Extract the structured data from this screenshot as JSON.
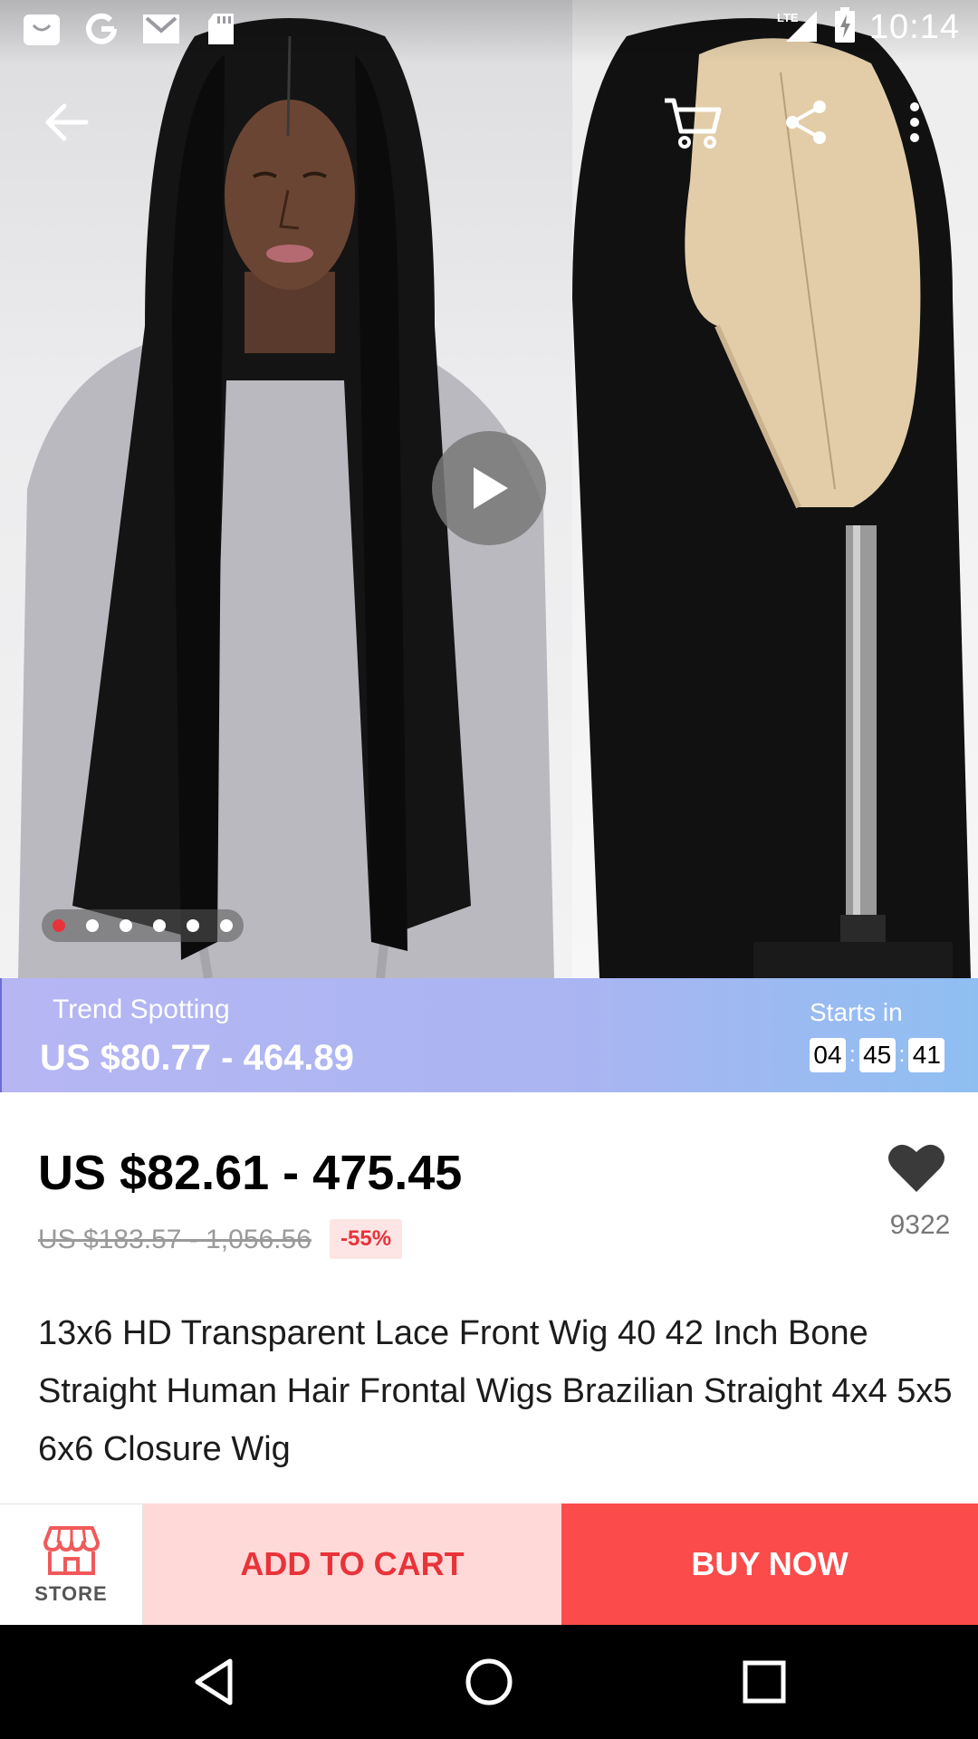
{
  "status_bar": {
    "time": "10:14",
    "network": "LTE",
    "left_icons": [
      "shopping-bag-icon",
      "google-icon",
      "gmail-icon",
      "sd-card-icon"
    ]
  },
  "toolbar": {
    "back_icon": "arrow-left-icon",
    "cart_icon": "cart-icon",
    "share_icon": "share-icon",
    "more_icon": "more-vertical-icon"
  },
  "gallery": {
    "image_count": 6,
    "active_index": 0
  },
  "trend": {
    "label": "Trend Spotting",
    "price": "US $80.77 - 464.89",
    "starts_label": "Starts in",
    "hours": "04",
    "minutes": "45",
    "seconds": "41",
    "separator": ":"
  },
  "product": {
    "price": "US $82.61 - 475.45",
    "original_price": "US $183.57 - 1,056.56",
    "discount": "-55%",
    "wishlist_count": "9322",
    "title": "13x6 HD Transparent Lace Front Wig 40 42 Inch Bone Straight Human Hair Frontal Wigs Brazilian Straight 4x4 5x5 6x6 Closure Wig"
  },
  "actions": {
    "store_label": "STORE",
    "add_to_cart": "ADD TO CART",
    "buy_now": "BUY NOW"
  },
  "colors": {
    "accent_red": "#fb4b4b",
    "add_cart_bg": "#ffd9d7",
    "discount_red": "#e8333a",
    "trend_gradient_start": "#b6b6f3",
    "trend_gradient_end": "#8fbff2"
  }
}
